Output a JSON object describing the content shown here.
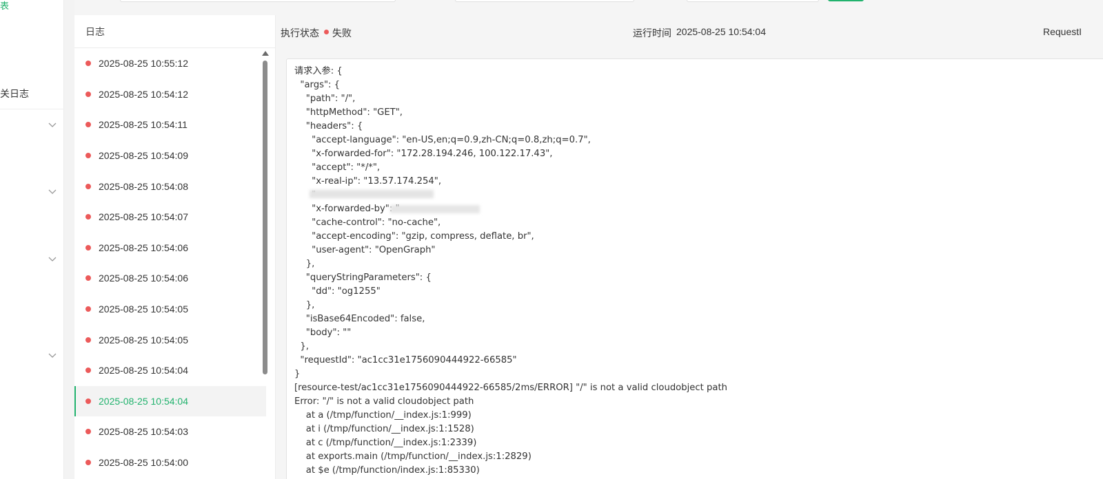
{
  "nav": {
    "cut_top_label": "表",
    "cut_log_label": "关日志",
    "chevron_icon": "chevron-down-icon"
  },
  "log_panel": {
    "title": "日志",
    "items": [
      "2025-08-25 10:55:12",
      "2025-08-25 10:54:12",
      "2025-08-25 10:54:11",
      "2025-08-25 10:54:09",
      "2025-08-25 10:54:08",
      "2025-08-25 10:54:07",
      "2025-08-25 10:54:06",
      "2025-08-25 10:54:06",
      "2025-08-25 10:54:05",
      "2025-08-25 10:54:05",
      "2025-08-25 10:54:04",
      "2025-08-25 10:54:04",
      "2025-08-25 10:54:03",
      "2025-08-25 10:54:00"
    ],
    "active_index": 11,
    "status_color": "#ec5a5a",
    "accent_color": "#21b26d"
  },
  "detail": {
    "status_label": "执行状态",
    "status_value": "失败",
    "run_time_label": "运行时间",
    "run_time_value": "2025-08-25 10:54:04",
    "request_label": "RequestI",
    "log_text": "请求入参: {\n  \"args\": {\n    \"path\": \"/\",\n    \"httpMethod\": \"GET\",\n    \"headers\": {\n      \"accept-language\": \"en-US,en;q=0.9,zh-CN;q=0.8,zh;q=0.7\",\n      \"x-forwarded-for\": \"172.28.194.246, 100.122.17.43\",\n      \"accept\": \"*/*\",\n      \"x-real-ip\": \"13.57.174.254\",\n      \"\n      \"x-forwarded-by\": \"\n      \"cache-control\": \"no-cache\",\n      \"accept-encoding\": \"gzip, compress, deflate, br\",\n      \"user-agent\": \"OpenGraph\"\n    },\n    \"queryStringParameters\": {\n      \"dd\": \"og1255\"\n    },\n    \"isBase64Encoded\": false,\n    \"body\": \"\"\n  },\n  \"requestId\": \"ac1cc31e1756090444922-66585\"\n}\n[resource-test/ac1cc31e1756090444922-66585/2ms/ERROR] \"/\" is not a valid cloudobject path\nError: \"/\" is not a valid cloudobject path\n    at a (/tmp/function/__index.js:1:999)\n    at i (/tmp/function/__index.js:1:1528)\n    at c (/tmp/function/__index.js:1:2339)\n    at exports.main (/tmp/function/__index.js:1:2829)\n    at $e (/tmp/function/index.js:1:85330)"
  }
}
